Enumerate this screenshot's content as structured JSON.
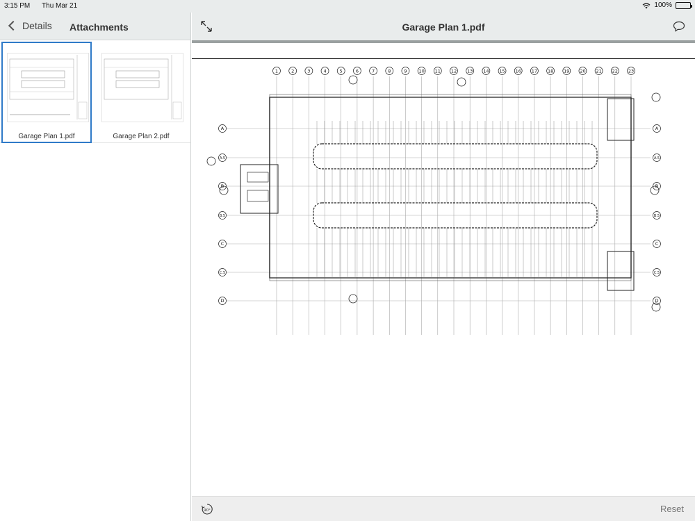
{
  "status_bar": {
    "time": "3:15 PM",
    "date": "Thu Mar 21",
    "battery": "100%",
    "battery_level": 1.0
  },
  "left_header": {
    "back_label": "Details",
    "title": "Attachments"
  },
  "attachments": [
    {
      "name": "Garage Plan 1.pdf",
      "selected": true
    },
    {
      "name": "Garage Plan 2.pdf",
      "selected": false
    }
  ],
  "viewer": {
    "title": "Garage Plan 1.pdf",
    "reset_label": "Reset",
    "rotate_label": "90°"
  },
  "drawing": {
    "grid_columns": [
      "1",
      "2",
      "3",
      "4",
      "5",
      "6",
      "7",
      "8",
      "9",
      "10",
      "11",
      "12",
      "13",
      "14",
      "15",
      "16",
      "17",
      "18",
      "19",
      "20",
      "21",
      "22",
      "23"
    ],
    "grid_rows": [
      "A",
      "A.5",
      "B",
      "B.5",
      "C",
      "C.5",
      "D"
    ]
  },
  "colors": {
    "accent": "#2f7ac8",
    "header_bg": "#e9ecec"
  }
}
